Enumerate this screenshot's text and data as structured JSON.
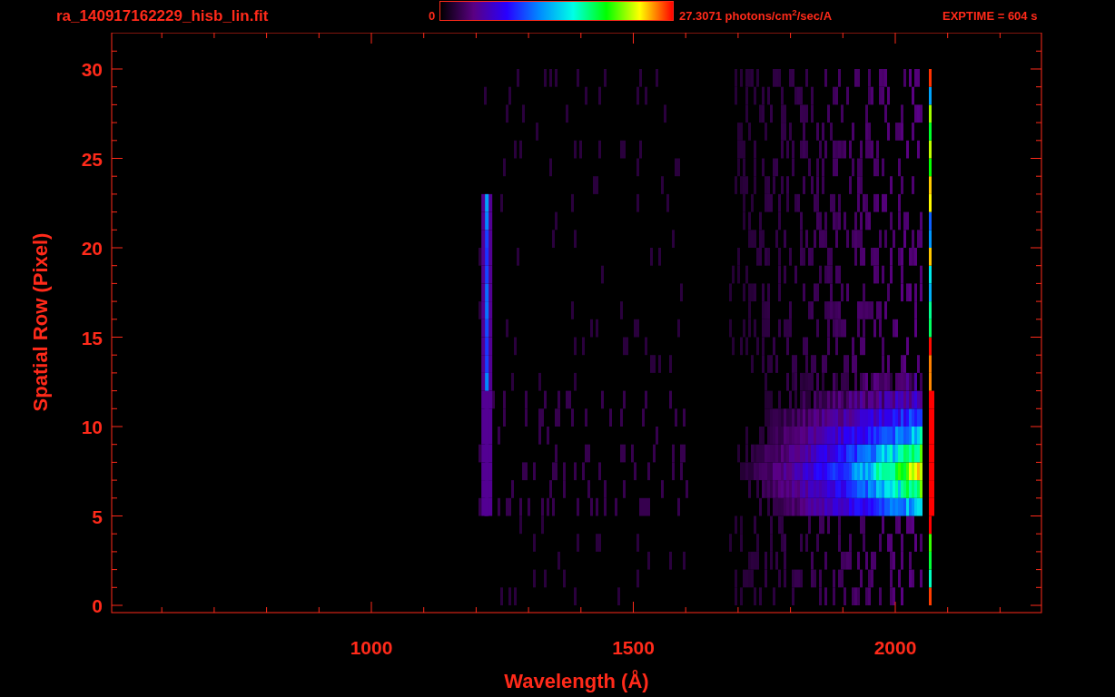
{
  "header": {
    "title": "ra_140917162229_hisb_lin.fit",
    "colorbar": {
      "min_label": "0",
      "max_label": "27.3071 photons/cm$^{2}$/sec/A"
    },
    "exptime": "EXPTIME = 604 s"
  },
  "plot": {
    "xlabel": "Wavelength (Å)",
    "ylabel": "Spatial Row (Pixel)",
    "xtick_labels": [
      "1000",
      "1500",
      "2000"
    ],
    "ytick_labels": [
      "30",
      "25",
      "20",
      "15",
      "10",
      "5",
      "0"
    ]
  }
}
